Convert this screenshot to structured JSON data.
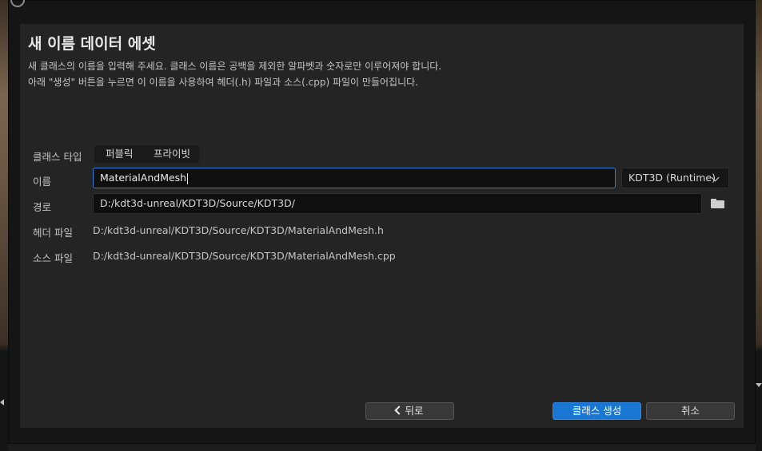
{
  "dialog": {
    "heading": "새 이름 데이터 에셋",
    "description_line1": "새 클래스의 이름을 입력해 주세요. 클래스 이름은 공백을 제외한 알파벳과 숫자로만 이루어져야 합니다.",
    "description_line2": "아래 \"생성\" 버튼을 누르면 이 이름을 사용하여 헤더(.h) 파일과 소스(.cpp) 파일이 만들어집니다."
  },
  "form": {
    "class_type_label": "클래스 타입",
    "class_type_options": [
      "퍼블릭",
      "프라이빗"
    ],
    "name_label": "이름",
    "name_value": "MaterialAndMesh",
    "module_value": "KDT3D (Runtime)",
    "path_label": "경로",
    "path_value": "D:/kdt3d-unreal/KDT3D/Source/KDT3D/",
    "header_file_label": "헤더 파일",
    "header_file_value": "D:/kdt3d-unreal/KDT3D/Source/KDT3D/MaterialAndMesh.h",
    "source_file_label": "소스 파일",
    "source_file_value": "D:/kdt3d-unreal/KDT3D/Source/KDT3D/MaterialAndMesh.cpp"
  },
  "buttons": {
    "back": "뒤로",
    "create": "클래스 생성",
    "cancel": "취소"
  },
  "icons": {
    "folder": "folder-icon",
    "module_dropdown": "chevron-down-icon",
    "back": "chevron-left-icon"
  },
  "colors": {
    "accent": "#1976d2",
    "panel": "#242424",
    "input_focus_border": "#2a80d8"
  }
}
